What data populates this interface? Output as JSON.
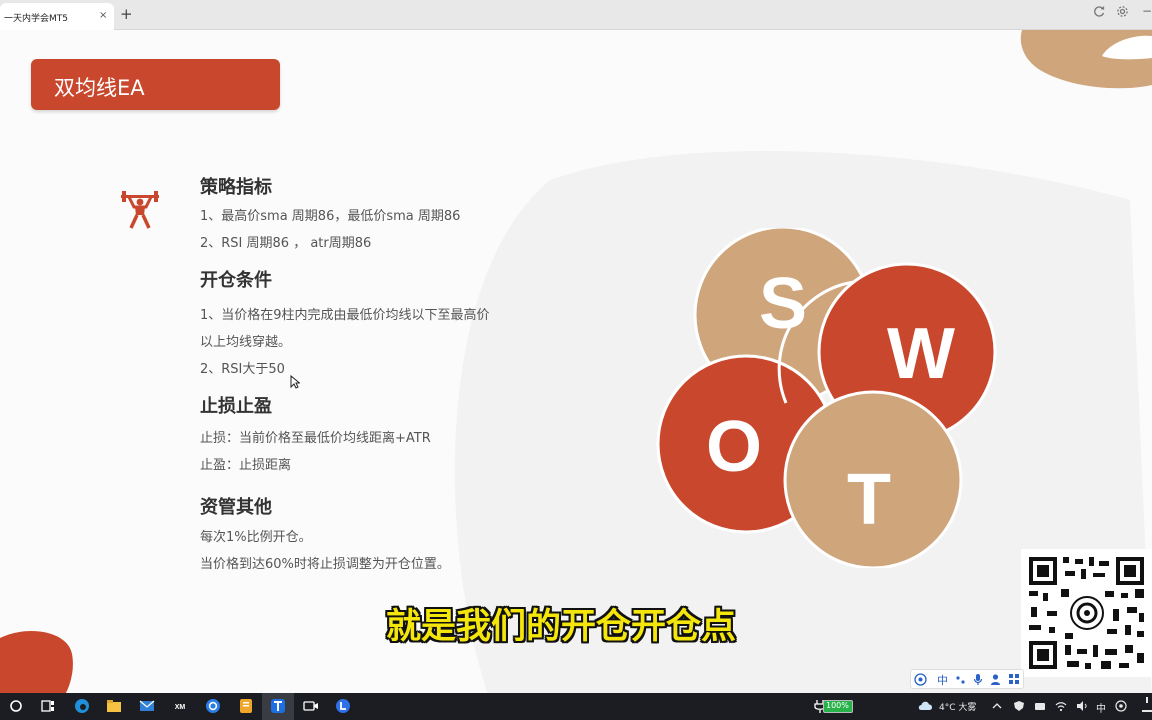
{
  "browser": {
    "tab_title": "一天内学会MT5",
    "close_glyph": "×",
    "new_tab_glyph": "+",
    "minimize_glyph": "−"
  },
  "slide": {
    "title": "双均线EA",
    "sections": [
      {
        "heading": "策略指标",
        "lines": [
          "1、最高价sma 周期86，最低价sma 周期86",
          "2、RSI 周期86 ， atr周期86"
        ]
      },
      {
        "heading": "开仓条件",
        "lines": [
          "1、当价格在9柱内完成由最低价均线以下至最高价",
          "以上均线穿越。",
          "2、RSI大于50"
        ]
      },
      {
        "heading": "止损止盈",
        "lines": [
          "止损：当前价格至最低价均线距离+ATR",
          "止盈：止损距离"
        ]
      },
      {
        "heading": "资管其他",
        "lines": [
          "每次1%比例开仓。",
          "当价格到达60%时将止损调整为开仓位置。"
        ]
      }
    ],
    "swot": {
      "s": "S",
      "w": "W",
      "o": "O",
      "t": "T"
    },
    "colors": {
      "accent": "#c9472c",
      "tan": "#cfa57c",
      "title_text": "#ffffff"
    }
  },
  "subtitle": "就是我们的开仓开仓点",
  "ime": {
    "lang": "中"
  },
  "taskbar": {
    "battery": "100%",
    "weather": "4°C 大雾",
    "lang": "中"
  }
}
